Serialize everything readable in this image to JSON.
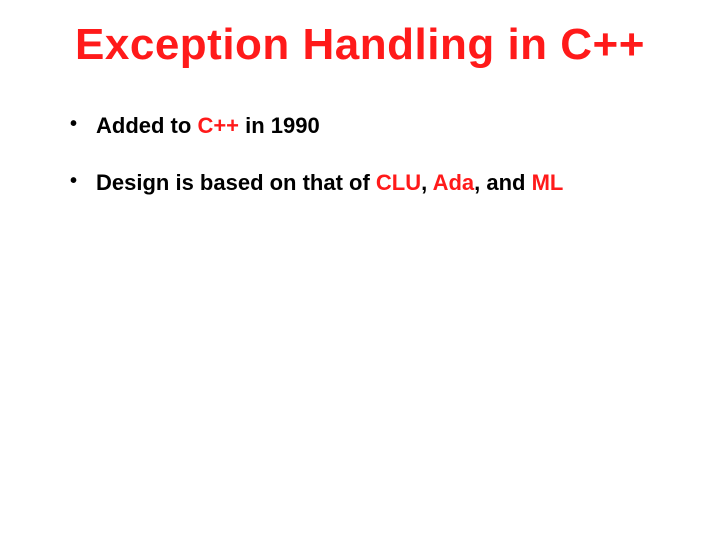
{
  "title": "Exception Handling in C++",
  "bullets": [
    {
      "pre": "Added to ",
      "accent1": "C++",
      "mid": " in 1990",
      "accent2": "",
      "mid2": "",
      "accent3": "",
      "tail": ""
    },
    {
      "pre": "Design is based on that of ",
      "accent1": "CLU",
      "mid": ", ",
      "accent2": "Ada",
      "mid2": ", and ",
      "accent3": "ML",
      "tail": ""
    }
  ]
}
